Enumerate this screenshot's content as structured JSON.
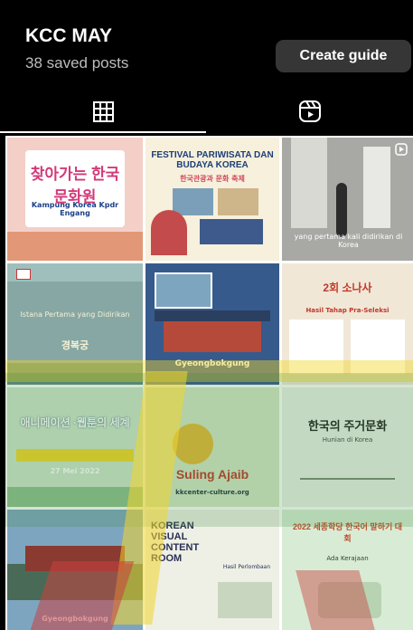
{
  "collection": {
    "title": "KCC MAY",
    "saved_count": "38 saved posts",
    "create_guide_label": "Create guide"
  },
  "tabs": [
    {
      "name": "grid",
      "icon": "grid-icon",
      "active": true
    },
    {
      "name": "reels",
      "icon": "reels-icon",
      "active": false
    }
  ],
  "posts": [
    {
      "title_ko": "찾아가는 한국문화원",
      "caption": "Kampung Korea Kpdr Engang",
      "bg": "#f3cfc8"
    },
    {
      "title": "FESTIVAL PARIWISATA DAN BUDAYA KOREA",
      "subtitle_ko": "한국관광과 문화 축제",
      "bg": "#f6f0dc"
    },
    {
      "caption": "yang pertama kali didirikan di Korea",
      "bg": "#a8a8a4"
    },
    {
      "caption_top": "Istana Pertama yang Didirikan",
      "caption_mid": "경복궁",
      "bg": "#87a7a4"
    },
    {
      "caption": "Gyeongbokgung",
      "bg": "#365a8c"
    },
    {
      "title": "2회 소나사",
      "caption": "Hasil Tahap Pra-Seleksi",
      "bg": "#f1e7d7"
    },
    {
      "title_ko": "애니메이션 ·웹툰의 세계",
      "caption": "27 Mei 2022",
      "bg": "#cfe5cd"
    },
    {
      "title": "Suling Ajaib",
      "caption": "kkcenter-culture.org",
      "bg": "#d4e6c7"
    },
    {
      "title_ko": "한국의 주거문화",
      "caption": "Hunian di Korea",
      "bg": "#eaf0e8"
    },
    {
      "caption": "Gyeongbokgung",
      "bg": "#7ea5c0"
    },
    {
      "title": "KOREAN VISUAL CONTENT ROOM",
      "caption": "Hasil Perlombaan",
      "bg": "#eef0e6"
    },
    {
      "title_ko": "2022 세종학당 한국어 말하기 대회",
      "caption": "Ada Kerajaan",
      "bg": "#d8ecd5"
    }
  ],
  "colors": {
    "background": "#000000",
    "button_bg": "#363636",
    "subtitle": "#bdbdbd",
    "overlay_green": "#3a8a3c",
    "overlay_yellow": "#f2d62c",
    "overlay_red": "#c94040"
  }
}
